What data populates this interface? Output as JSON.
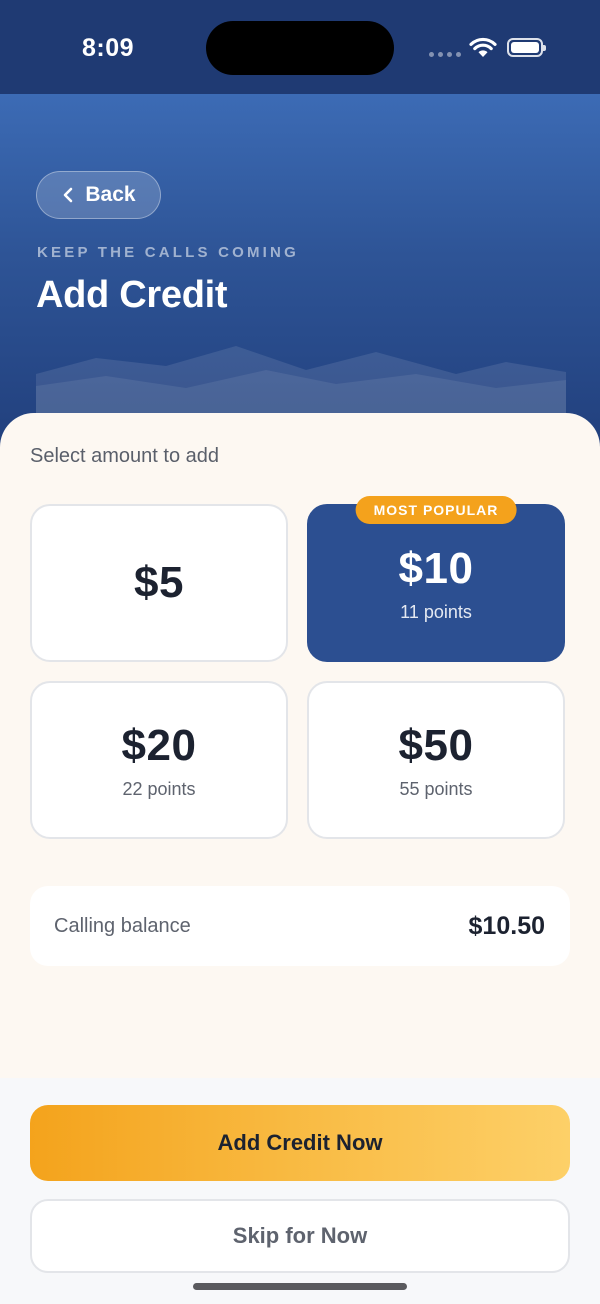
{
  "status_bar": {
    "time": "8:09",
    "icons": [
      "signal-dots-icon",
      "wifi-icon",
      "battery-icon"
    ]
  },
  "header": {
    "back_label": "Back",
    "eyebrow": "KEEP THE CALLS COMING",
    "title": "Add Credit"
  },
  "content": {
    "section_label": "Select amount to add",
    "options": [
      {
        "amount": "$5",
        "points": ""
      },
      {
        "amount": "$10",
        "points": "11 points",
        "badge": "MOST POPULAR",
        "selected": true
      },
      {
        "amount": "$20",
        "points": "22 points"
      },
      {
        "amount": "$50",
        "points": "55 points"
      }
    ],
    "balance": {
      "label": "Calling balance",
      "value": "$10.50"
    }
  },
  "actions": {
    "primary_label": "Add Credit Now",
    "secondary_label": "Skip for Now"
  },
  "colors": {
    "header_top": "#3c6bb5",
    "header_bottom": "#213f7c",
    "selected_card": "#2c4f91",
    "accent": "#f4a21c",
    "sheet_background": "#fdf8f2"
  }
}
